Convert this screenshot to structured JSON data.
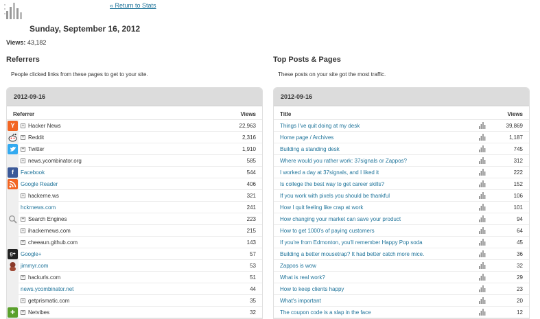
{
  "header": {
    "return_label": "« Return to Stats",
    "date": "Sunday, September 16, 2012",
    "views_label": "Views:",
    "views_total": "43,182"
  },
  "referrers": {
    "title": "Referrers",
    "description": "People clicked links from these pages to get to your site.",
    "date": "2012-09-16",
    "col_name": "Referrer",
    "col_views": "Views",
    "rows": [
      {
        "label": "Hacker News",
        "views": "22,963",
        "icon": "hacker-news-icon",
        "expand": true,
        "link": false
      },
      {
        "label": "Reddit",
        "views": "2,316",
        "icon": "reddit-icon",
        "expand": true,
        "link": false
      },
      {
        "label": "Twitter",
        "views": "1,910",
        "icon": "twitter-icon",
        "expand": true,
        "link": false
      },
      {
        "label": "news.ycombinator.org",
        "views": "585",
        "icon": "blank-icon",
        "expand": true,
        "link": false
      },
      {
        "label": "Facebook",
        "views": "544",
        "icon": "facebook-icon",
        "expand": false,
        "link": true
      },
      {
        "label": "Google Reader",
        "views": "406",
        "icon": "rss-icon",
        "expand": false,
        "link": true
      },
      {
        "label": "hackerne.ws",
        "views": "321",
        "icon": "blank-icon",
        "expand": true,
        "link": false
      },
      {
        "label": "hckrnews.com",
        "views": "241",
        "icon": "blank-icon",
        "expand": false,
        "link": true
      },
      {
        "label": "Search Engines",
        "views": "223",
        "icon": "search-icon",
        "expand": true,
        "link": false
      },
      {
        "label": "ihackernews.com",
        "views": "215",
        "icon": "blank-icon",
        "expand": true,
        "link": false
      },
      {
        "label": "cheeaun.github.com",
        "views": "143",
        "icon": "blank-icon",
        "expand": true,
        "link": false
      },
      {
        "label": "Google+",
        "views": "57",
        "icon": "google-plus-icon",
        "expand": false,
        "link": true
      },
      {
        "label": "jimmyr.com",
        "views": "53",
        "icon": "jimmyr-icon",
        "expand": false,
        "link": true
      },
      {
        "label": "hackurls.com",
        "views": "51",
        "icon": "blank-icon",
        "expand": true,
        "link": false
      },
      {
        "label": "news.ycombinator.net",
        "views": "44",
        "icon": "blank-icon",
        "expand": false,
        "link": true
      },
      {
        "label": "getprismatic.com",
        "views": "35",
        "icon": "blank-icon",
        "expand": true,
        "link": false
      },
      {
        "label": "Netvibes",
        "views": "32",
        "icon": "netvibes-icon",
        "expand": true,
        "link": false
      }
    ]
  },
  "posts": {
    "title": "Top Posts & Pages",
    "description": "These posts on your site got the most traffic.",
    "date": "2012-09-16",
    "col_name": "Title",
    "col_views": "Views",
    "rows": [
      {
        "label": "Things I've quit doing at my desk",
        "views": "39,869"
      },
      {
        "label": "Home page / Archives",
        "views": "1,187"
      },
      {
        "label": "Building a standing desk",
        "views": "745"
      },
      {
        "label": "Where would you rather work: 37signals or Zappos?",
        "views": "312"
      },
      {
        "label": "I worked a day at 37signals, and I liked it",
        "views": "222"
      },
      {
        "label": "Is college the best way to get career skills?",
        "views": "152"
      },
      {
        "label": "If you work with pixels you should be thankful",
        "views": "106"
      },
      {
        "label": "How I quit feeling like crap at work",
        "views": "101"
      },
      {
        "label": "How changing your market can save your product",
        "views": "94"
      },
      {
        "label": "How to get 1000's of paying customers",
        "views": "64"
      },
      {
        "label": "If you're from Edmonton, you'll remember Happy Pop soda",
        "views": "45"
      },
      {
        "label": "Building a better mousetrap? It had better catch more mice.",
        "views": "36"
      },
      {
        "label": "Zappos is wow",
        "views": "32"
      },
      {
        "label": "What is real work?",
        "views": "29"
      },
      {
        "label": "How to keep clients happy",
        "views": "23"
      },
      {
        "label": "What's important",
        "views": "20"
      },
      {
        "label": "The coupon code is a slap in the face",
        "views": "12"
      }
    ]
  },
  "colors": {
    "link": "#21759b",
    "header_bg": "#dcdcdc"
  }
}
